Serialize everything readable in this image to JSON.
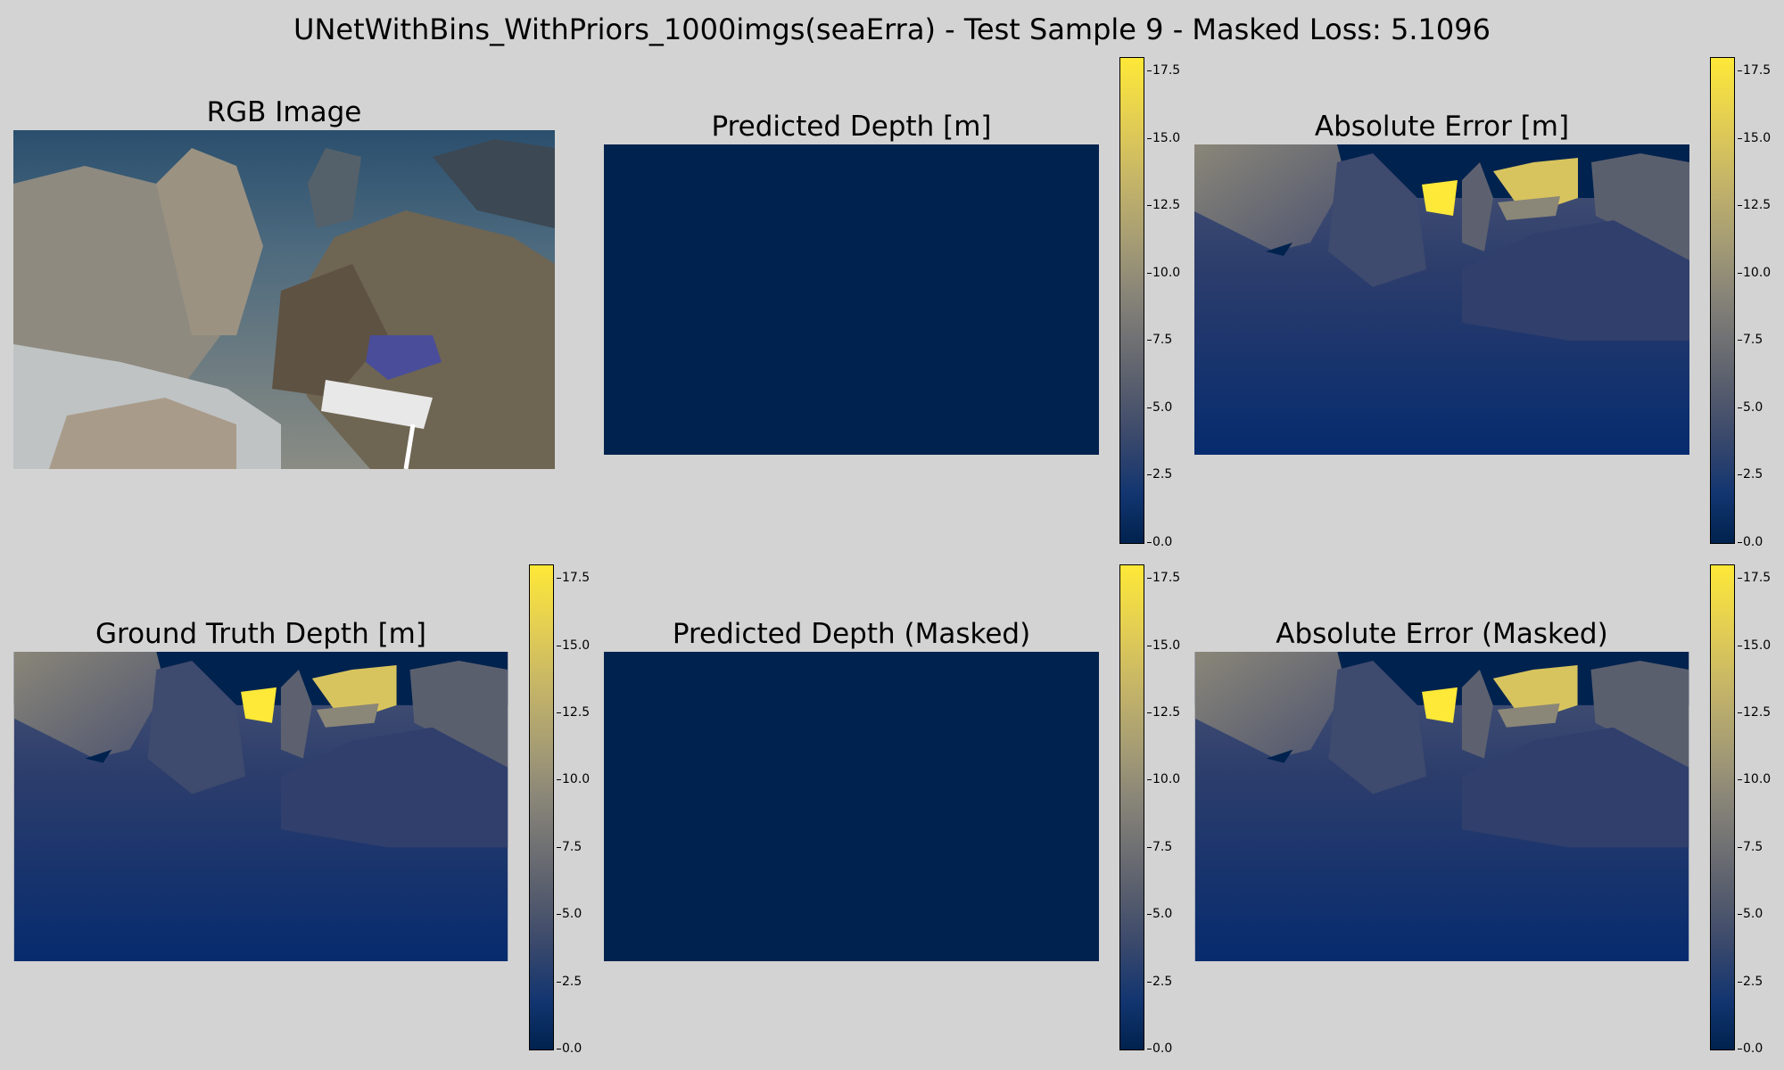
{
  "suptitle": "UNetWithBins_WithPriors_1000imgs(seaErra) - Test Sample 9 - Masked Loss: 5.1096",
  "panels": {
    "rgb": {
      "title": "RGB Image"
    },
    "pred": {
      "title": "Predicted Depth [m]"
    },
    "abs_err": {
      "title": "Absolute Error [m]"
    },
    "gt": {
      "title": "Ground Truth Depth [m]"
    },
    "pred_masked": {
      "title": "Predicted Depth (Masked)"
    },
    "abs_err_masked": {
      "title": "Absolute Error (Masked)"
    }
  },
  "colormap": "cividis",
  "colors": {
    "cmap_min": "#00224e",
    "cmap_max": "#fee838",
    "background": "#d3d3d3"
  },
  "chart_data": {
    "type": "heatmap",
    "title": "UNetWithBins_WithPriors_1000imgs(seaErra) - Test Sample 9 - Masked Loss: 5.1096",
    "masked_loss": 5.1096,
    "colorbar": {
      "range": [
        0,
        18
      ],
      "ticks": [
        0.0,
        2.5,
        5.0,
        7.5,
        10.0,
        12.5,
        15.0,
        17.5
      ],
      "tick_labels": [
        "0.0",
        "2.5",
        "5.0",
        "7.5",
        "10.0",
        "12.5",
        "15.0",
        "17.5"
      ]
    },
    "predicted_depth_value": 0.0
  }
}
